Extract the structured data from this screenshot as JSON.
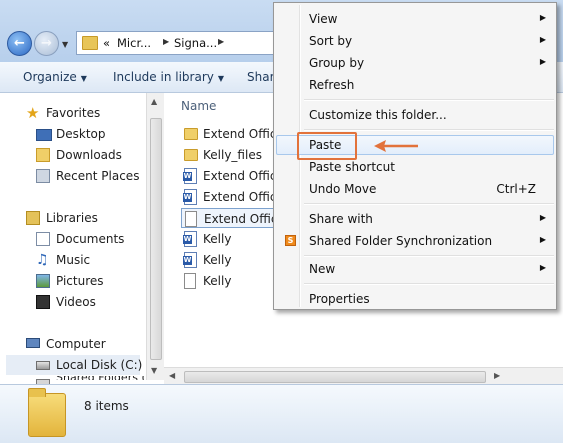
{
  "address": {
    "segments": [
      "«",
      "Micr...",
      "Signa..."
    ]
  },
  "toolbar": {
    "organize": "Organize",
    "include": "Include in library",
    "share": "Share"
  },
  "nav": {
    "items": [
      {
        "label": "Favorites",
        "icon": "star-icon"
      },
      {
        "label": "Desktop",
        "icon": "desktop-icon"
      },
      {
        "label": "Downloads",
        "icon": "downloads-icon"
      },
      {
        "label": "Recent Places",
        "icon": "recent-places-icon"
      },
      {
        "label": "Libraries",
        "icon": "libraries-icon"
      },
      {
        "label": "Documents",
        "icon": "documents-icon"
      },
      {
        "label": "Music",
        "icon": "music-icon"
      },
      {
        "label": "Pictures",
        "icon": "pictures-icon"
      },
      {
        "label": "Videos",
        "icon": "videos-icon"
      },
      {
        "label": "Computer",
        "icon": "computer-icon"
      },
      {
        "label": "Local Disk (C:)",
        "icon": "disk-icon"
      },
      {
        "label": "Shared Folders (",
        "icon": "shared-folders-icon"
      }
    ]
  },
  "content": {
    "column_header": "Name",
    "files": [
      {
        "name": "Extend Office",
        "type": "folder"
      },
      {
        "name": "Kelly_files",
        "type": "folder"
      },
      {
        "name": "Extend Office",
        "type": "word"
      },
      {
        "name": "Extend Office",
        "type": "word"
      },
      {
        "name": "Extend Office",
        "type": "text"
      },
      {
        "name": "Kelly",
        "type": "word"
      },
      {
        "name": "Kelly",
        "type": "word"
      },
      {
        "name": "Kelly",
        "type": "text"
      }
    ]
  },
  "details": {
    "count": "8 items"
  },
  "menu": {
    "items": [
      {
        "label": "View",
        "submenu": true
      },
      {
        "label": "Sort by",
        "submenu": true
      },
      {
        "label": "Group by",
        "submenu": true
      },
      {
        "label": "Refresh"
      },
      {
        "label": "Customize this folder..."
      },
      {
        "label": "Paste"
      },
      {
        "label": "Paste shortcut"
      },
      {
        "label": "Undo Move",
        "shortcut": "Ctrl+Z"
      },
      {
        "label": "Share with",
        "submenu": true
      },
      {
        "label": "Shared Folder Synchronization",
        "submenu": true
      },
      {
        "label": "New",
        "submenu": true
      },
      {
        "label": "Properties"
      }
    ]
  },
  "colors": {
    "highlight_box": "#e2723b",
    "accent": "#1e395b"
  }
}
